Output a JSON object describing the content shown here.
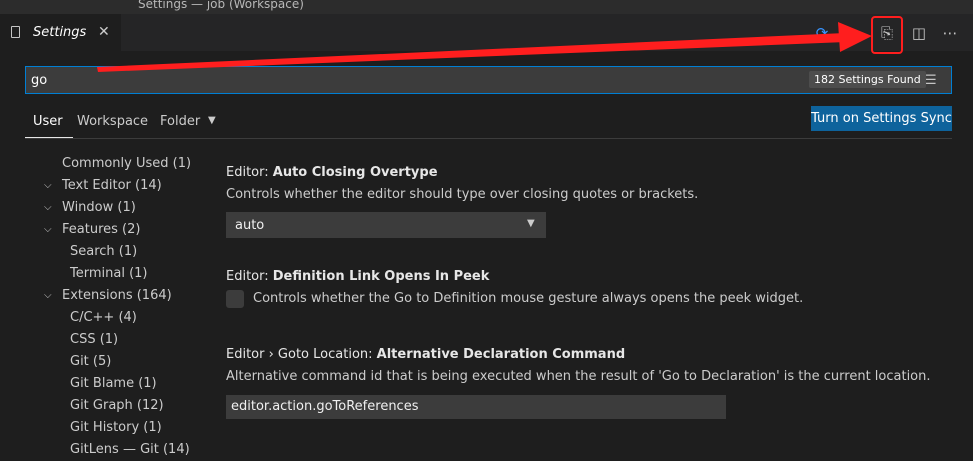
{
  "window": {
    "title": "Settings — job (Workspace)"
  },
  "tab": {
    "label": "Settings",
    "close": "✕"
  },
  "actions": {
    "sync_icon": "⟳",
    "run_icon": "▷",
    "json_icon": "⎘",
    "split_icon": "◫",
    "more_icon": "⋯"
  },
  "search": {
    "value": "go",
    "count": "182 Settings Found",
    "filter_icon": "☰"
  },
  "scopes": {
    "user": "User",
    "workspace": "Workspace",
    "folder": "Folder",
    "caret": "▼"
  },
  "sync_button": "Turn on Settings Sync",
  "toc": [
    {
      "label": "Commonly Used (1)",
      "chevron": ""
    },
    {
      "label": "Text Editor (14)",
      "chevron": "⌵"
    },
    {
      "label": "Window (1)",
      "chevron": "⌵"
    },
    {
      "label": "Features (2)",
      "chevron": "⌵"
    },
    {
      "label": "Search (1)",
      "chevron": ""
    },
    {
      "label": "Terminal (1)",
      "chevron": ""
    },
    {
      "label": "Extensions (164)",
      "chevron": "⌵"
    },
    {
      "label": "C/C++ (4)",
      "chevron": ""
    },
    {
      "label": "CSS (1)",
      "chevron": ""
    },
    {
      "label": "Git (5)",
      "chevron": ""
    },
    {
      "label": "Git Blame (1)",
      "chevron": ""
    },
    {
      "label": "Git Graph (12)",
      "chevron": ""
    },
    {
      "label": "Git History (1)",
      "chevron": ""
    },
    {
      "label": "GitLens — Git (14)",
      "chevron": ""
    }
  ],
  "settings": [
    {
      "category": "Editor: ",
      "name": "Auto Closing Overtype",
      "description": "Controls whether the editor should type over closing quotes or brackets.",
      "value": "auto"
    },
    {
      "category": "Editor: ",
      "name": "Definition Link Opens In Peek",
      "description": "Controls whether the Go to Definition mouse gesture always opens the peek widget."
    },
    {
      "category": "Editor › Goto Location: ",
      "name": "Alternative Declaration Command",
      "description": "Alternative command id that is being executed when the result of 'Go to Declaration' is the current location.",
      "value": "editor.action.goToReferences"
    }
  ]
}
